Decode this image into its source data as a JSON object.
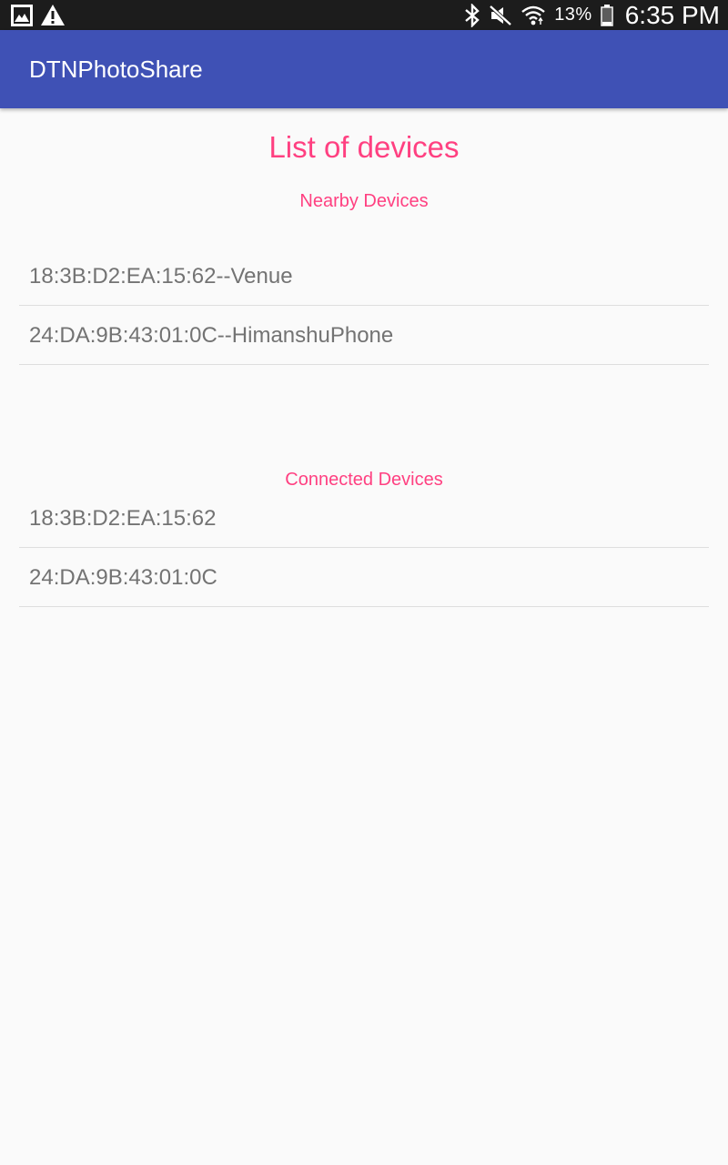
{
  "status_bar": {
    "left_icons": [
      "gallery-icon",
      "warning-icon"
    ],
    "right_icons": [
      "bluetooth-icon",
      "mute-icon",
      "wifi-icon",
      "battery-icon"
    ],
    "battery_percent": "13%",
    "time": "6:35 PM"
  },
  "app_bar": {
    "title": "DTNPhotoShare",
    "color": "#3f51b5"
  },
  "main": {
    "heading": "List of devices",
    "accent_color": "#ff4081",
    "nearby": {
      "heading": "Nearby Devices",
      "items": [
        {
          "label": "18:3B:D2:EA:15:62--Venue"
        },
        {
          "label": "24:DA:9B:43:01:0C--HimanshuPhone"
        }
      ]
    },
    "connected": {
      "heading": "Connected Devices",
      "items": [
        {
          "label": "18:3B:D2:EA:15:62"
        },
        {
          "label": "24:DA:9B:43:01:0C"
        }
      ]
    }
  }
}
